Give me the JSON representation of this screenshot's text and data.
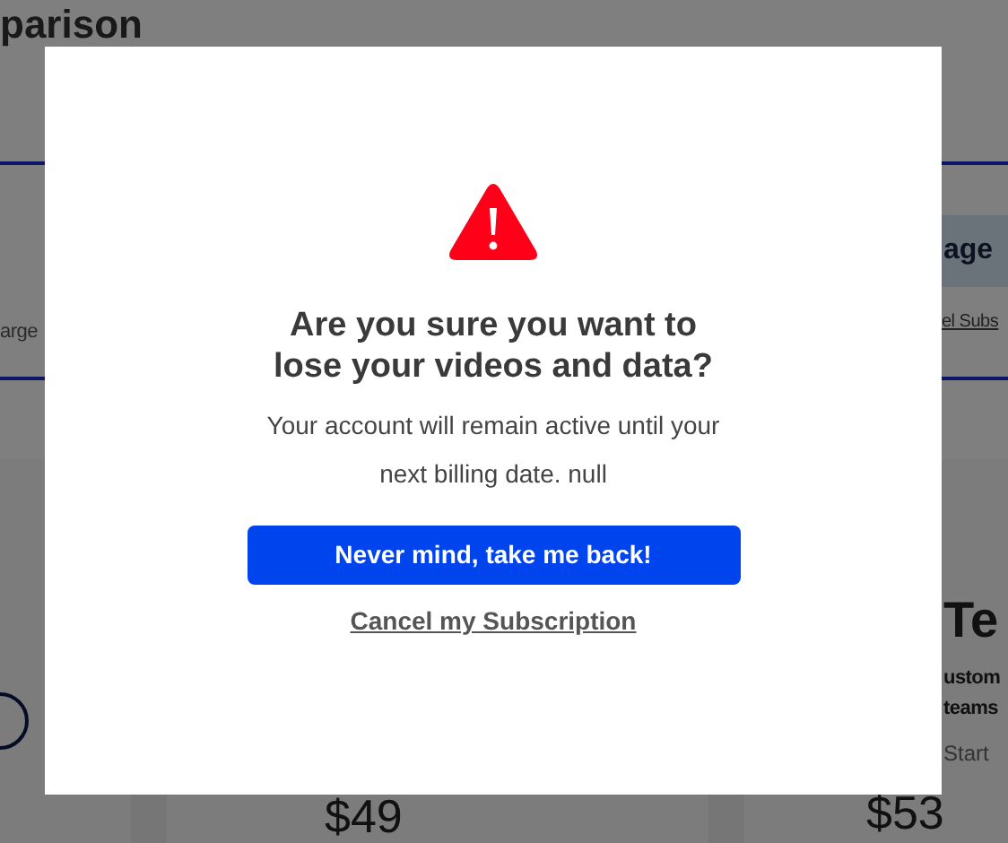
{
  "page": {
    "title": "parison",
    "tab_label": "age",
    "left_caption": "arge",
    "right_link": "el Subs",
    "plans": [
      {
        "kind": "button_only"
      },
      {
        "kind": "price",
        "price": "$49"
      },
      {
        "kind": "full",
        "name": "Te",
        "description": [
          "ustom",
          "teams"
        ],
        "starting": "Start",
        "price": "$53"
      }
    ]
  },
  "dialog": {
    "heading": "Are you sure you want to lose your videos and data?",
    "body": "Your account will remain active until your next billing date. null",
    "primary_button": "Never mind, take me back!",
    "cancel_link": "Cancel my Subscription"
  }
}
